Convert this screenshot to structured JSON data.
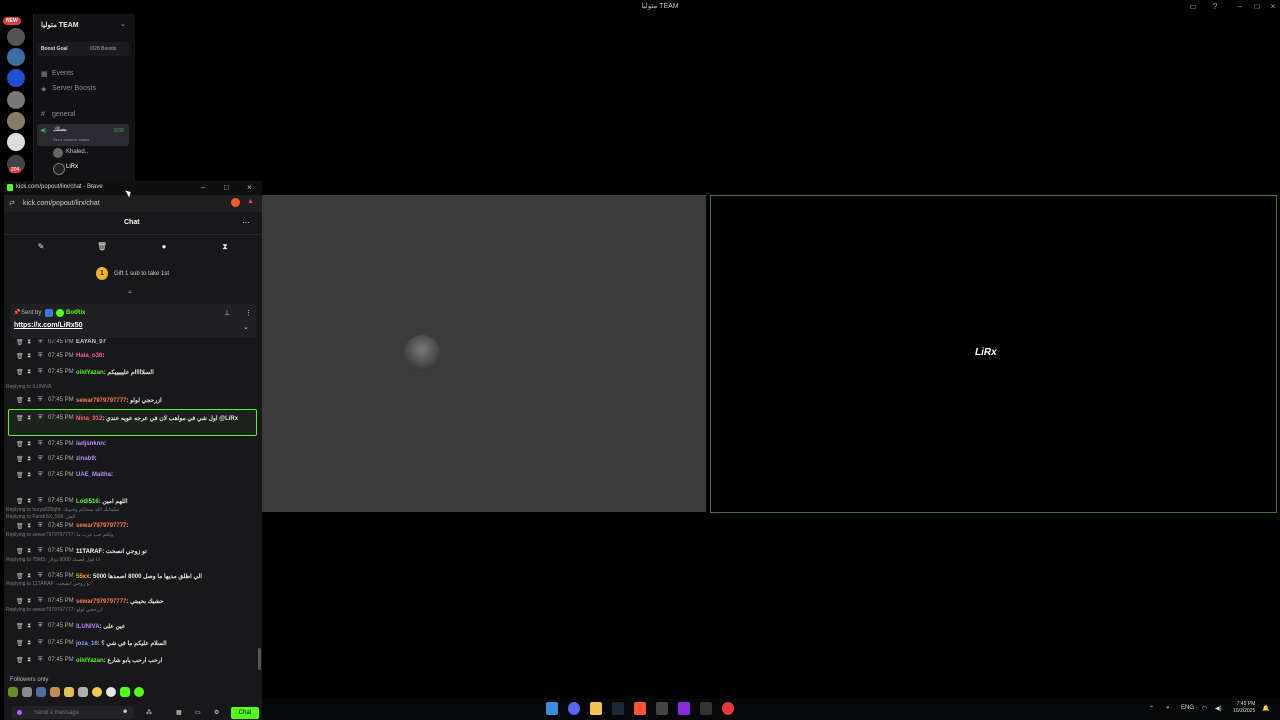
{
  "window": {
    "title": "متوليا TEAM"
  },
  "discord": {
    "new_badge": "NEW",
    "server_name": "متوليا TEAM",
    "boost_goal": "Boost Goal",
    "boost_count": "0/28 Boosts",
    "nav": [
      "Events",
      "Server Boosts"
    ],
    "channel_general": "general",
    "voice_channel": "بصلك",
    "voice_count": "9/30",
    "voice_status": "Set a channel status",
    "voice_users": [
      "Khaled..",
      "LiRx"
    ],
    "mention_badge": "204"
  },
  "stream": {
    "logo": "LiRx"
  },
  "browser": {
    "title": "kick.com/popout/lirx/chat - Brave",
    "url": "kick.com/popout/lirx/chat"
  },
  "chat": {
    "header": "Chat",
    "gift_count": "1",
    "gift_text": "Gift 1 sub to take 1st",
    "pinned": {
      "sent_by": "Sent by",
      "user": "BotRix",
      "link": "https://x.com/LiRx50"
    },
    "messages": [
      {
        "time": "07:45 PM",
        "user": "EAYAN_07",
        "text": "",
        "color": "#d0d0d0"
      },
      {
        "time": "07:45 PM",
        "user": "Hala_o36",
        "text": ":",
        "color": "#ff5fa2"
      },
      {
        "time": "07:45 PM",
        "user": "oildYazan",
        "text": ": السلااااام عليييييكم",
        "color": "#53fc18"
      },
      {
        "time": "07:45 PM",
        "user": "sewar7979797777",
        "text": ": ازرحجي لولو",
        "color": "#ff7a45"
      },
      {
        "time": "07:45 PM",
        "user": "Nina_912",
        "text": ": اول شي في مواهب لان في عرجه عويه عندي @LiRx",
        "color": "#ff5f7a"
      },
      {
        "time": "07:45 PM",
        "user": "ladjsnknn",
        "text": ":",
        "color": "#b98cff"
      },
      {
        "time": "07:45 PM",
        "user": "zinab9",
        "text": ":",
        "color": "#b98cff"
      },
      {
        "time": "07:45 PM",
        "user": "UAE_Maitha",
        "text": ":",
        "color": "#b98cff"
      },
      {
        "time": "07:45 PM",
        "user": "Lodi516",
        "text": ": اللهم امين",
        "color": "#53fc18"
      },
      {
        "time": "07:45 PM",
        "user": "sewar7979797777",
        "text": ":",
        "color": "#ff7a45"
      },
      {
        "time": "07:45 PM",
        "user": "11TARAF",
        "text": ": تو زوجي انصحت",
        "color": "#ffffff"
      },
      {
        "time": "07:45 PM",
        "user": "55xx",
        "text": ": الي اطلق مديها ما وصل 8000 اصمدها 5000",
        "color": "#ffb020"
      },
      {
        "time": "07:45 PM",
        "user": "sewar7979797777",
        "text": ": حشيك بحيبتي",
        "color": "#ff7a45"
      },
      {
        "time": "07:45 PM",
        "user": "ILUNIVA",
        "text": ": عين على",
        "color": "#c77dff"
      },
      {
        "time": "07:45 PM",
        "user": "joza_16",
        "text": ": السلام عليكم ما في شي ؟",
        "color": "#7aa7ff"
      },
      {
        "time": "07:45 PM",
        "user": "oildYazan",
        "text": ": ارحب ارحب يابو شارع",
        "color": "#53fc18"
      }
    ],
    "replies": [
      "Replying to ILUNIVA",
      "Replying to horya505qht: سلمانك الله بمحاكم وحبينك",
      "Replying to FarahSX_506: الش",
      "Replying to sewar7979797777: ولكم حب عرب ما",
      "Replying to 75MS: اتا قول قصنك 8000 دولار",
      "Replying to 11TARAF: تو زوجي انصحت",
      "Replying to sewar7979797777: ازرحجي لولو"
    ],
    "followers_only": "Followers only",
    "input_placeholder": "Send a message",
    "send_label": "Chat"
  },
  "taskbar": {
    "lang": "ENG",
    "time": "7:45 PM",
    "date": "10/2/2025"
  },
  "colors": {
    "kick_green": "#53fc18",
    "bg": "#000000"
  }
}
